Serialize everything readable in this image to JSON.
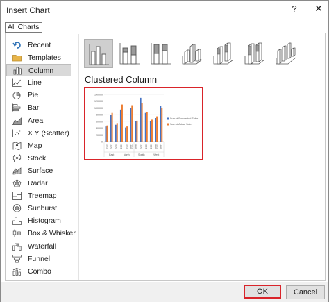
{
  "window": {
    "title": "Insert Chart",
    "help_glyph": "?",
    "close_glyph": "✕"
  },
  "tabs": [
    {
      "label": "All Charts"
    }
  ],
  "sidebar": {
    "items": [
      {
        "label": "Recent",
        "icon": "recent-icon"
      },
      {
        "label": "Templates",
        "icon": "templates-folder-icon"
      },
      {
        "label": "Column",
        "icon": "column-chart-icon",
        "selected": true
      },
      {
        "label": "Line",
        "icon": "line-chart-icon"
      },
      {
        "label": "Pie",
        "icon": "pie-chart-icon"
      },
      {
        "label": "Bar",
        "icon": "bar-chart-icon"
      },
      {
        "label": "Area",
        "icon": "area-chart-icon"
      },
      {
        "label": "X Y (Scatter)",
        "icon": "scatter-chart-icon"
      },
      {
        "label": "Map",
        "icon": "map-chart-icon"
      },
      {
        "label": "Stock",
        "icon": "stock-chart-icon"
      },
      {
        "label": "Surface",
        "icon": "surface-chart-icon"
      },
      {
        "label": "Radar",
        "icon": "radar-chart-icon"
      },
      {
        "label": "Treemap",
        "icon": "treemap-chart-icon"
      },
      {
        "label": "Sunburst",
        "icon": "sunburst-chart-icon"
      },
      {
        "label": "Histogram",
        "icon": "histogram-chart-icon"
      },
      {
        "label": "Box & Whisker",
        "icon": "box-whisker-chart-icon"
      },
      {
        "label": "Waterfall",
        "icon": "waterfall-chart-icon"
      },
      {
        "label": "Funnel",
        "icon": "funnel-chart-icon"
      },
      {
        "label": "Combo",
        "icon": "combo-chart-icon"
      }
    ]
  },
  "subtypes": [
    {
      "icon": "clustered-column-icon",
      "selected": true
    },
    {
      "icon": "stacked-column-icon"
    },
    {
      "icon": "100-stacked-column-icon"
    },
    {
      "icon": "3d-clustered-column-icon"
    },
    {
      "icon": "3d-stacked-column-icon"
    },
    {
      "icon": "3d-100-stacked-column-icon"
    },
    {
      "icon": "3d-column-icon"
    }
  ],
  "selected_chart_name": "Clustered Column",
  "preview": {
    "colors": {
      "series1": "#4472c4",
      "series2": "#ed7d31",
      "accent": "#d9242a"
    },
    "chart_data": {
      "type": "bar",
      "ylim": [
        0,
        140000
      ],
      "y_ticks": [
        "0",
        "20000",
        "40000",
        "60000",
        "80000",
        "100000",
        "120000",
        "140000"
      ],
      "categories": [
        "2020",
        "2021",
        "2020",
        "2021",
        "2020",
        "2021",
        "2020",
        "2021",
        "2020",
        "2021",
        "2020",
        "2021"
      ],
      "groups": [
        "East",
        "North",
        "South",
        "West"
      ],
      "legend_position": "right",
      "series": [
        {
          "name": "Sum of Forecasted Sales",
          "values": [
            45000,
            80000,
            50000,
            95000,
            42000,
            100000,
            60000,
            130000,
            85000,
            60000,
            70000,
            105000
          ]
        },
        {
          "name": "Sum of Actual Sales",
          "values": [
            48000,
            85000,
            55000,
            110000,
            45000,
            108000,
            62000,
            115000,
            88000,
            65000,
            75000,
            100000
          ]
        }
      ]
    }
  },
  "footer": {
    "ok_label": "OK",
    "cancel_label": "Cancel"
  }
}
